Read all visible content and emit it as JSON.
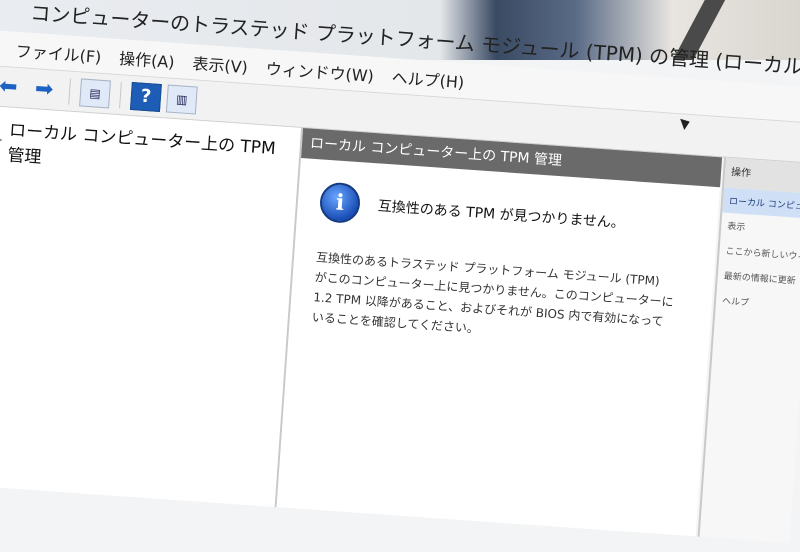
{
  "window": {
    "title": "コンピューターのトラステッド プラットフォーム モジュール (TPM) の管理 (ローカル コンピューター)"
  },
  "menubar": {
    "items": [
      "ファイル(F)",
      "操作(A)",
      "表示(V)",
      "ウィンドウ(W)",
      "ヘルプ(H)"
    ]
  },
  "toolbar": {
    "help_label": "?"
  },
  "tree": {
    "root_label": "ローカル コンピューター上の TPM 管理"
  },
  "main": {
    "header": "ローカル コンピューター上の TPM 管理",
    "info_title": "互換性のある TPM が見つかりません。",
    "info_body": "互換性のあるトラステッド プラットフォーム モジュール (TPM) がこのコンピューター上に見つかりません。このコンピューターに 1.2 TPM 以降があること、およびそれが BIOS 内で有効になっていることを確認してください。"
  },
  "actions": {
    "header": "操作",
    "items": [
      "ローカル コンピュ...",
      "表示",
      "ここから新しいウィ...",
      "最新の情報に更新",
      "ヘルプ"
    ]
  },
  "colors": {
    "section_header_bg": "#6a6a6a",
    "accent_blue": "#1d5db5"
  }
}
